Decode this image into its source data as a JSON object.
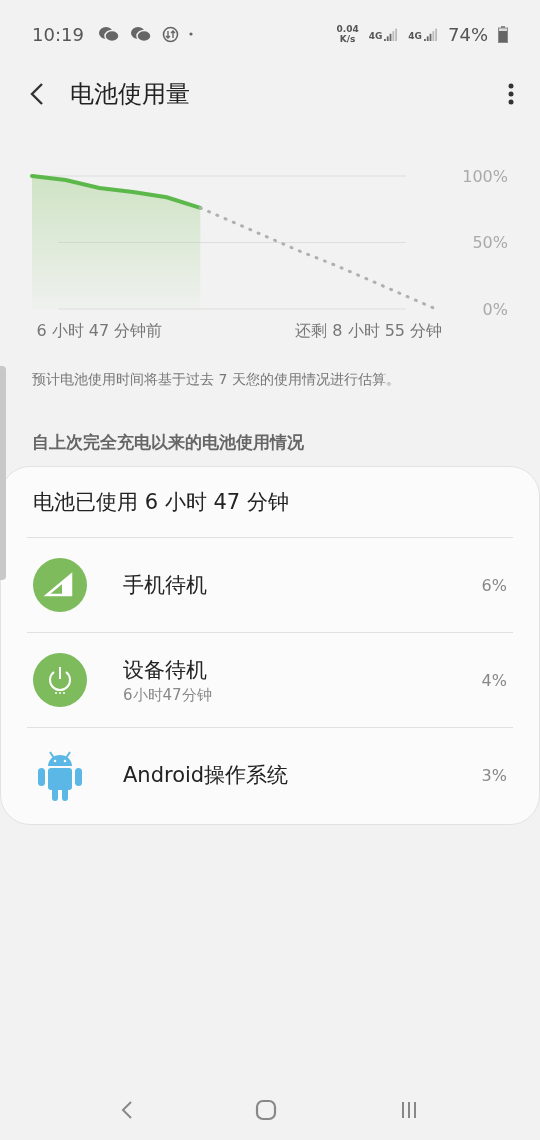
{
  "status_bar": {
    "time": "10:19",
    "speed_value": "0.04",
    "speed_unit": "K/s",
    "networks": [
      "4G",
      "4G"
    ],
    "battery": "74%"
  },
  "header": {
    "title": "电池使用量"
  },
  "chart": {
    "chart_data": {
      "type": "line",
      "categories": [
        null,
        null,
        "6 小时 47 分钟前",
        null,
        null,
        null,
        null,
        null,
        null,
        null,
        "还剩 8 小时 55 分钟",
        null,
        null
      ],
      "ylim": [
        0,
        100
      ],
      "yticks": [
        {
          "value": 0,
          "label": "0%"
        },
        {
          "value": 50,
          "label": "50%"
        },
        {
          "value": 100,
          "label": "100%"
        }
      ],
      "series": [
        {
          "color": "#5cb84a",
          "line_style": "solid",
          "values": [
            100,
            97,
            91,
            88,
            84,
            76,
            null,
            null,
            null,
            null,
            null,
            null,
            null
          ]
        },
        {
          "color": "#b0b0b0",
          "line_style": "dotted",
          "values": [
            null,
            null,
            null,
            null,
            null,
            76,
            65,
            54,
            43,
            33,
            22,
            11,
            0
          ]
        }
      ]
    }
  },
  "note": "预计电池使用时间将基于过去 7 天您的使用情况进行估算。",
  "section_title": "自上次完全充电以来的电池使用情况",
  "usage": {
    "summary": "电池已使用 6 小时 47 分钟",
    "items": [
      {
        "kind": "signal",
        "title": "手机待机",
        "percent": "6%"
      },
      {
        "kind": "power",
        "title": "设备待机",
        "subtitle": "6小时47分钟",
        "percent": "4%"
      },
      {
        "kind": "android",
        "title": "Android操作系统",
        "percent": "3%"
      }
    ]
  }
}
